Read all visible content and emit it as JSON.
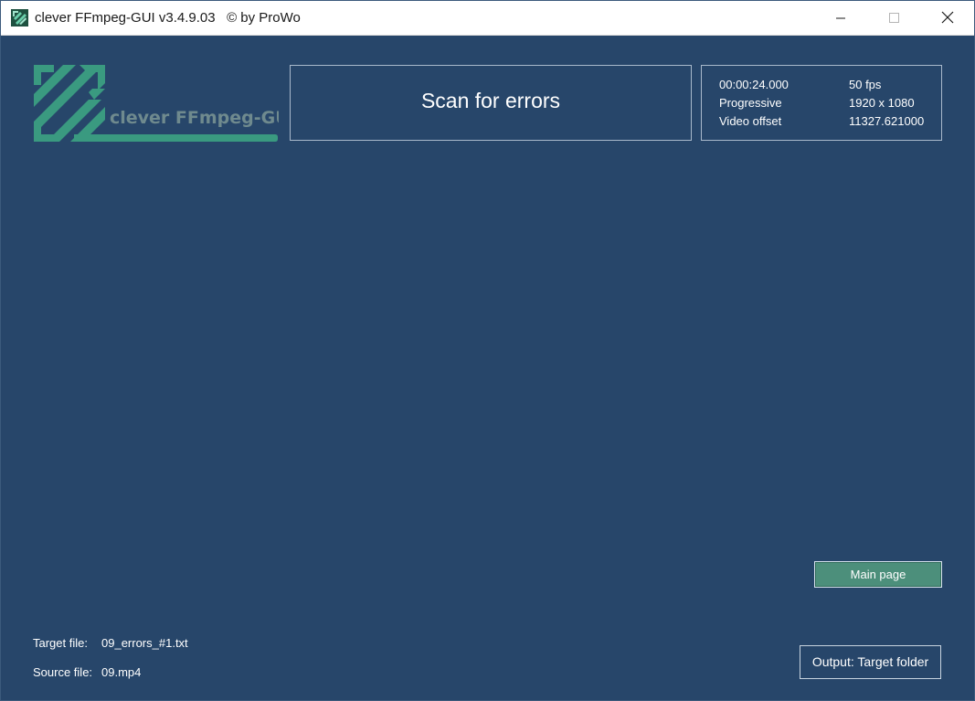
{
  "window": {
    "title": "clever FFmpeg-GUI v3.4.9.03   © by ProWo",
    "controls": {
      "minimize": "minimize-icon",
      "maximize": "maximize-icon",
      "close": "close-icon"
    }
  },
  "logo": {
    "text": "clever FFmpeg-GUI",
    "color": "#3a9a80"
  },
  "scan_panel": {
    "title": "Scan for errors"
  },
  "info": {
    "duration": "00:00:24.000",
    "fps": "50 fps",
    "scan_type": "Progressive",
    "resolution": "1920 x 1080",
    "offset_label": "Video offset",
    "offset_value": "11327.621000"
  },
  "buttons": {
    "main_page": "Main page",
    "output": "Output: Target folder"
  },
  "files": {
    "target_label": "Target file:",
    "target_value": "09_errors_#1.txt",
    "source_label": "Source file:",
    "source_value": "09.mp4"
  },
  "colors": {
    "background": "#27466a",
    "accent_green": "#4c8f7b",
    "panel_border": "#a9b9cb"
  }
}
